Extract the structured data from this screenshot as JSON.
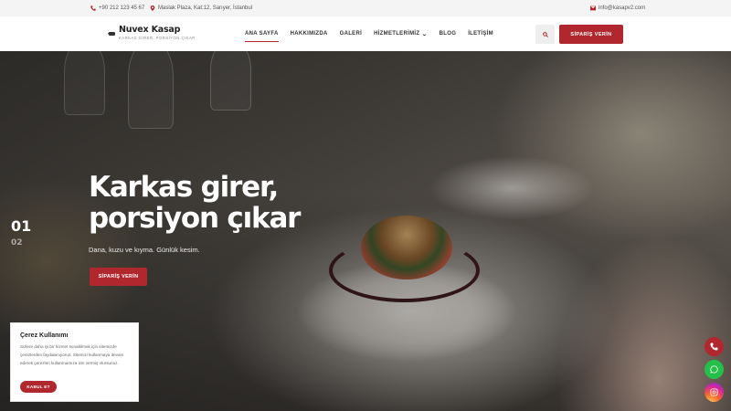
{
  "topbar": {
    "phone": "+90 212 123 45 67",
    "address": "Maslak Plaza, Kat:12, Sarıyer, İstanbul",
    "email": "info@kasapv2.com"
  },
  "brand": {
    "name": "Nuvex Kasap",
    "tagline": "KARKAS GİRER, PORSİYON ÇIKAR"
  },
  "nav": {
    "items": [
      {
        "label": "ANA SAYFA",
        "active": true
      },
      {
        "label": "HAKKIMIZDA"
      },
      {
        "label": "GALERİ"
      },
      {
        "label": "HİZMETLERİMİZ",
        "dropdown": true
      },
      {
        "label": "BLOG"
      },
      {
        "label": "İLETİŞİM"
      }
    ],
    "order_label": "SİPARİŞ VERİN"
  },
  "hero": {
    "title": "Karkas girer, porsiyon çıkar",
    "subtitle": "Dana, kuzu ve kıyma. Günlük kesim.",
    "button_label": "SİPARİŞ VERİN",
    "slides": [
      "01",
      "02"
    ],
    "active_slide": "01"
  },
  "cookie": {
    "title": "Çerez Kullanımı",
    "text": "Sizlere daha iyi bir hizmet sunabilmek için sitemizde çerezlerden faydalanıyoruz. Sitemizi kullanmaya devam ederek çerezleri kullanmamıza izin vermiş olursunuz.",
    "accept_label": "KABUL ET"
  },
  "floating": {
    "buttons": [
      "phone-icon",
      "whatsapp-icon",
      "instagram-icon"
    ]
  },
  "colors": {
    "accent": "#b0282e",
    "whatsapp": "#25c04a"
  }
}
